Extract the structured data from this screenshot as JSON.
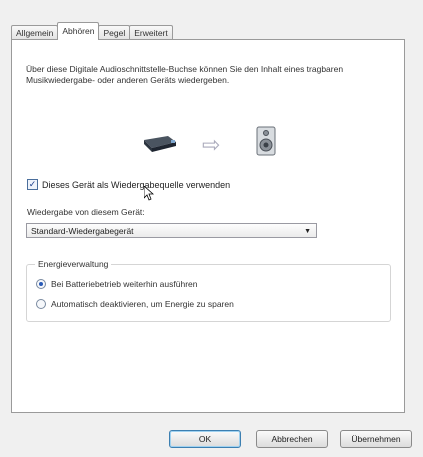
{
  "tabs": [
    "Allgemein",
    "Abhören",
    "Pegel",
    "Erweitert"
  ],
  "active_tab": "Abhören",
  "description": "Über diese Digitale Audioschnittstelle-Buchse können Sie den Inhalt eines tragbaren Musikwiedergabe- oder anderen Geräts wiedergeben.",
  "icons": {
    "source": "sound-card-icon",
    "arrow": "arrow-right-icon",
    "target": "speaker-icon"
  },
  "listen_checkbox": {
    "label": "Dieses Gerät als Wiedergabequelle verwenden",
    "checked": true
  },
  "playback_label": "Wiedergabe von diesem Gerät:",
  "playback_device": "Standard-Wiedergabegerät",
  "power": {
    "title": "Energieverwaltung",
    "options": [
      {
        "label": "Bei Batteriebetrieb weiterhin ausführen",
        "selected": true
      },
      {
        "label": "Automatisch deaktivieren, um Energie zu sparen",
        "selected": false
      }
    ]
  },
  "buttons": {
    "ok": "OK",
    "cancel": "Abbrechen",
    "apply": "Übernehmen"
  }
}
